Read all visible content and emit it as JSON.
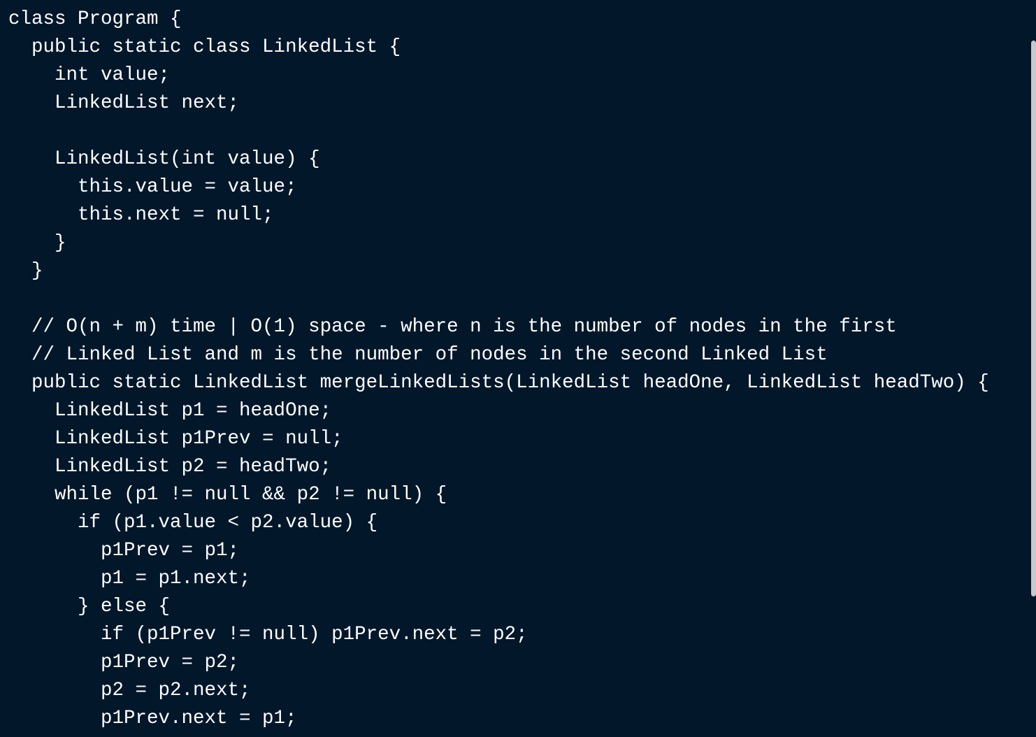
{
  "code": {
    "lines": [
      "class Program {",
      "  public static class LinkedList {",
      "    int value;",
      "    LinkedList next;",
      "",
      "    LinkedList(int value) {",
      "      this.value = value;",
      "      this.next = null;",
      "    }",
      "  }",
      "",
      "  // O(n + m) time | O(1) space - where n is the number of nodes in the first",
      "  // Linked List and m is the number of nodes in the second Linked List",
      "  public static LinkedList mergeLinkedLists(LinkedList headOne, LinkedList headTwo) {",
      "    LinkedList p1 = headOne;",
      "    LinkedList p1Prev = null;",
      "    LinkedList p2 = headTwo;",
      "    while (p1 != null && p2 != null) {",
      "      if (p1.value < p2.value) {",
      "        p1Prev = p1;",
      "        p1 = p1.next;",
      "      } else {",
      "        if (p1Prev != null) p1Prev.next = p2;",
      "        p1Prev = p2;",
      "        p2 = p2.next;",
      "        p1Prev.next = p1;"
    ]
  },
  "colors": {
    "background": "#03172b",
    "text": "#ffffff",
    "scrollbar_thumb": "#c8c8c8"
  }
}
